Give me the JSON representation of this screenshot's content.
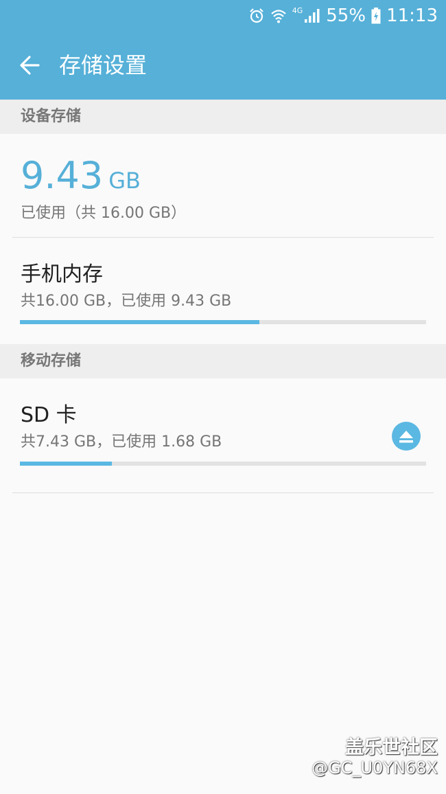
{
  "status_bar": {
    "network_label": "4G",
    "battery_percent": "55%",
    "time": "11:13",
    "icons": [
      "alarm-icon",
      "wifi-icon",
      "signal-icon",
      "battery-charging-icon"
    ]
  },
  "app_bar": {
    "title": "存储设置",
    "back_icon": "arrow-left-icon"
  },
  "device_storage": {
    "section_title": "设备存储",
    "used_value": "9.43",
    "used_unit": "GB",
    "used_caption": "已使用（共 16.00 GB）"
  },
  "internal_storage": {
    "title": "手机内存",
    "detail": "共16.00 GB，已使用 9.43 GB",
    "used_fraction": 0.5895
  },
  "portable_storage": {
    "section_title": "移动存储",
    "sd_card": {
      "title": "SD 卡",
      "detail": "共7.43 GB，已使用 1.68 GB",
      "used_fraction": 0.2261,
      "eject_icon": "eject-icon"
    }
  },
  "watermark": {
    "line1": "盖乐世社区",
    "line2": "@GC_U0YN68X"
  },
  "colors": {
    "accent": "#56b0d8",
    "progress": "#5bb8e2",
    "track": "#e2e2e2",
    "background": "#fafafa",
    "section_header": "#eeeeee"
  }
}
